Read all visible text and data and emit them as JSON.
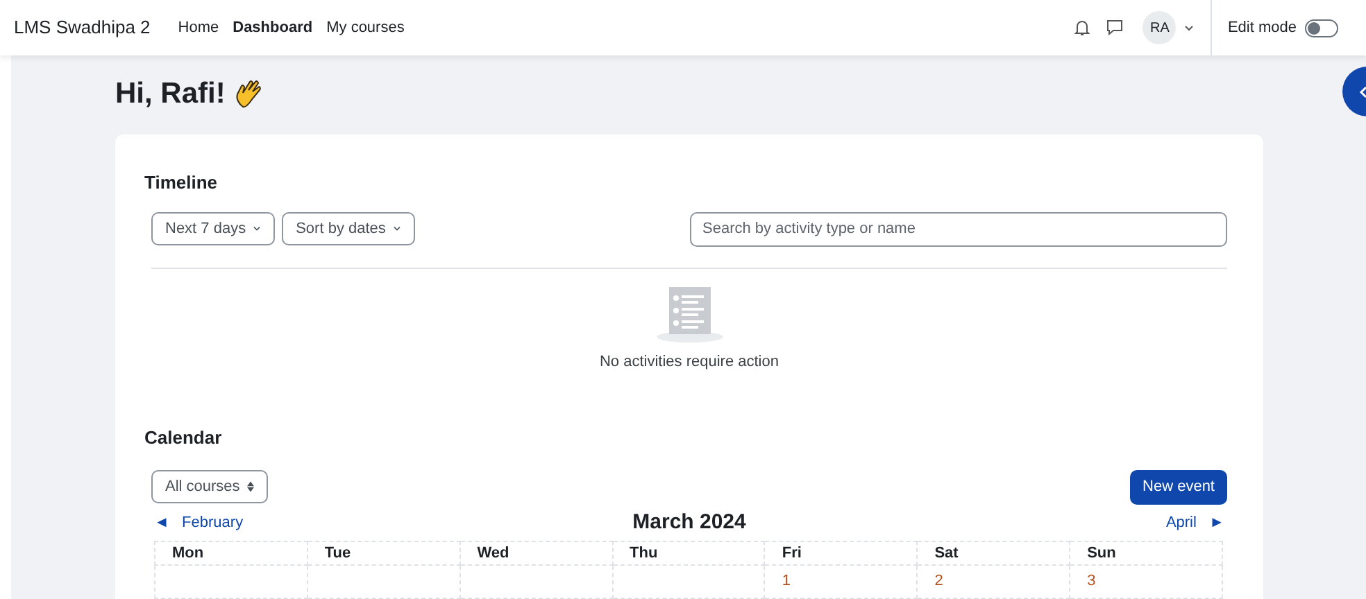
{
  "site_name": "LMS Swadhipa 2",
  "nav": [
    {
      "label": "Home",
      "selected": false
    },
    {
      "label": "Dashboard",
      "selected": true
    },
    {
      "label": "My courses",
      "selected": false
    }
  ],
  "user_initials": "RA",
  "edit_mode": {
    "label": "Edit mode",
    "on": false
  },
  "greeting": "Hi, Rafi!",
  "timeline": {
    "title": "Timeline",
    "filters": [
      "Next 7 days",
      "Sort by dates"
    ],
    "search": {
      "placeholder": "Search by activity type or name"
    },
    "empty_message": "No activities require action"
  },
  "calendar": {
    "title": "Calendar",
    "course_filter": "All courses",
    "new_event": "New event",
    "prev": {
      "arrow": "◄",
      "label": "February"
    },
    "month": "March 2024",
    "next": {
      "arrow": "►",
      "label": "April"
    },
    "days": [
      "Mon",
      "Tue",
      "Wed",
      "Thu",
      "Fri",
      "Sat",
      "Sun"
    ],
    "weeks": [
      [
        {
          "kind": "blank"
        },
        {
          "kind": "blank"
        },
        {
          "kind": "blank"
        },
        {
          "kind": "blank"
        },
        {
          "kind": "day",
          "date": "1"
        },
        {
          "kind": "day",
          "date": "2"
        },
        {
          "kind": "day",
          "date": "3"
        }
      ]
    ]
  }
}
